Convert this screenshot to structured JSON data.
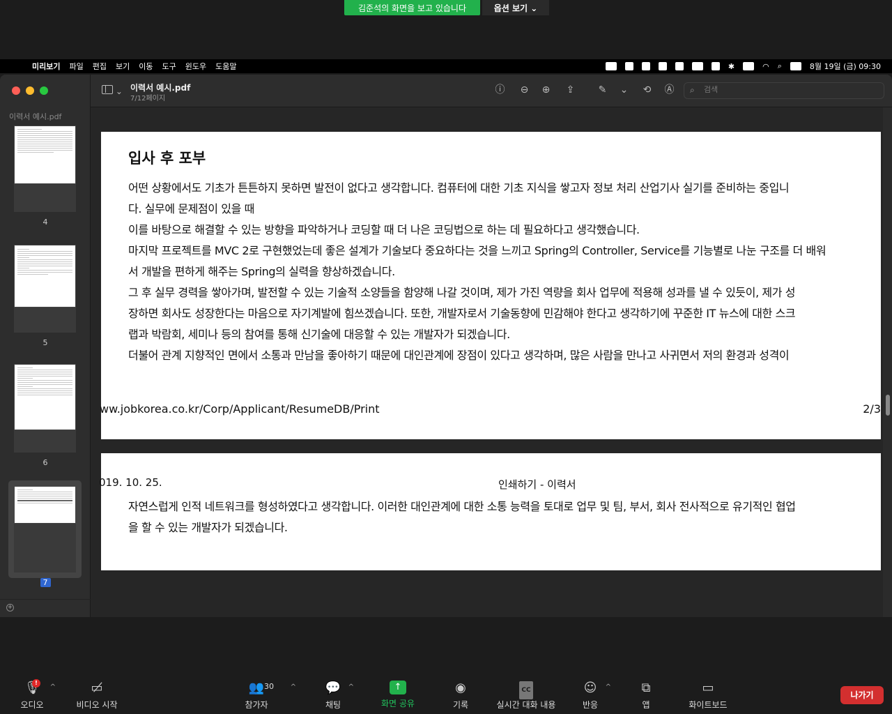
{
  "share_banner": {
    "viewing_text": "김준석의 화면을 보고 있습니다",
    "options_label": "옵션 보기 ⌄"
  },
  "menubar": {
    "app_name": "미리보기",
    "items": [
      "파일",
      "편집",
      "보기",
      "이동",
      "도구",
      "윈도우",
      "도움말"
    ],
    "datetime": "8월 19일 (금) 09:30"
  },
  "preview": {
    "sidebar_title": "이력서 예시.pdf",
    "thumbnails": [
      {
        "page": "4"
      },
      {
        "page": "5"
      },
      {
        "page": "6"
      },
      {
        "page": "7"
      }
    ],
    "doc_title": "이력서 예시.pdf",
    "page_indicator": "7/12페이지",
    "search_placeholder": "검색"
  },
  "document": {
    "page1": {
      "heading": "입사 후 포부",
      "lines": [
        "어떤 상황에서도 기초가 튼튼하지 못하면 발전이 없다고 생각합니다. 컴퓨터에 대한 기초 지식을 쌓고자 정보 처리 산업기사 실기를 준비하는 중입니",
        "다. 실무에 문제점이 있을 때",
        "이를 바탕으로 해결할 수 있는 방향을 파악하거나 코딩할 때 더 나은 코딩법으로 하는 데 필요하다고 생각했습니다.",
        "마지막 프로젝트를 MVC 2로 구현했었는데 좋은 설계가 기술보다 중요하다는 것을 느끼고 Spring의 Controller, Service를 기능별로 나눈 구조를 더 배워",
        "서 개발을 편하게 해주는 Spring의 실력을 향상하겠습니다.",
        "그 후 실무 경력을 쌓아가며, 발전할 수 있는 기술적 소양들을 함양해 나갈 것이며, 제가 가진 역량을 회사 업무에 적용해 성과를 낼 수 있듯이, 제가 성",
        "장하면 회사도 성장한다는 마음으로 자기계발에 힘쓰겠습니다. 또한, 개발자로서 기술동향에 민감해야 한다고 생각하기에 꾸준한 IT 뉴스에 대한 스크",
        "랩과 박람회, 세미나 등의 참여를 통해 신기술에 대응할 수 있는 개발자가 되겠습니다.",
        "더불어 관계 지향적인 면에서 소통과 만남을 좋아하기 때문에 대인관계에 장점이 있다고 생각하며, 많은 사람을 만나고 사귀면서 저의 환경과 성격이"
      ],
      "footer_url": "ww.jobkorea.co.kr/Corp/Applicant/ResumeDB/Print",
      "footer_page": "2/3"
    },
    "page2": {
      "header_date": "019. 10. 25.",
      "header_title": "인쇄하기 - 이력서",
      "lines": [
        "자연스럽게 인적 네트워크를 형성하였다고 생각합니다. 이러한 대인관계에 대한 소통 능력을 토대로 업무 및 팀, 부서, 회사 전사적으로 유기적인 협업",
        "을 할 수 있는 개발자가 되겠습니다."
      ]
    }
  },
  "zoom_toolbar": {
    "audio": "오디오",
    "audio_badge": "!",
    "video": "비디오 시작",
    "participants": "참가자",
    "participant_count": "30",
    "chat": "채팅",
    "share": "화면 공유",
    "record": "기록",
    "cc_icon": "CC",
    "captions": "실시간 대화 내용",
    "reactions": "반응",
    "apps": "앱",
    "whiteboard": "화이트보드",
    "leave": "나가기"
  }
}
